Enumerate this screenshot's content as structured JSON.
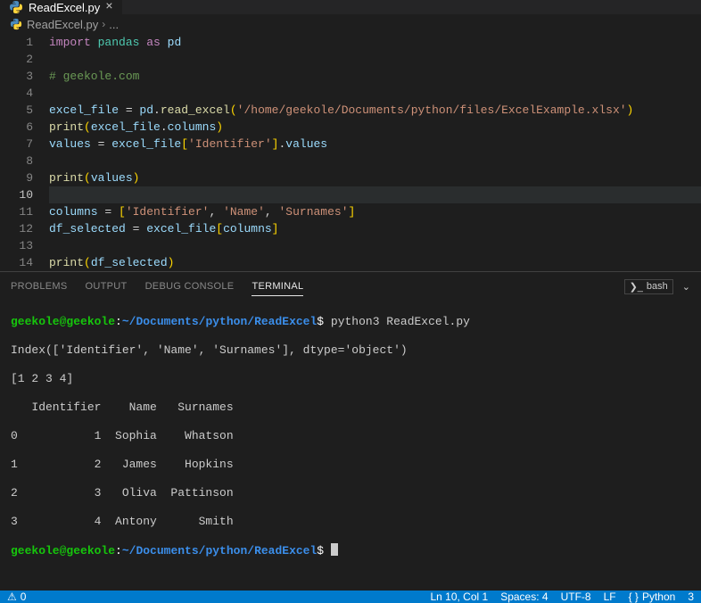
{
  "tab": {
    "filename": "ReadExcel.py"
  },
  "breadcrumb": {
    "filename": "ReadExcel.py",
    "more": "..."
  },
  "code": {
    "l1_import": "import",
    "l1_pandas": "pandas",
    "l1_as": "as",
    "l1_pd": "pd",
    "l3_comment": "# geekole.com",
    "l5_var": "excel_file",
    "l5_eq": " = ",
    "l5_pd": "pd",
    "l5_read": "read_excel",
    "l5_path": "'/home/geekole/Documents/python/files/ExcelExample.xlsx'",
    "l6_print": "print",
    "l6_arg": "excel_file",
    "l6_prop": "columns",
    "l7_values": "values",
    "l7_eq": " = ",
    "l7_file": "excel_file",
    "l7_key": "'Identifier'",
    "l7_valprop": "values",
    "l9_print": "print",
    "l9_arg": "values",
    "l11_cols": "columns",
    "l11_eq": " = ",
    "l11_id": "'Identifier'",
    "l11_name": "'Name'",
    "l11_sur": "'Surnames'",
    "l12_df": "df_selected",
    "l12_eq": " = ",
    "l12_file": "excel_file",
    "l12_cols": "columns",
    "l14_print": "print",
    "l14_arg": "df_selected"
  },
  "lineNumbers": [
    "1",
    "2",
    "3",
    "4",
    "5",
    "6",
    "7",
    "8",
    "9",
    "10",
    "11",
    "12",
    "13",
    "14"
  ],
  "panelTabs": {
    "problems": "PROBLEMS",
    "output": "OUTPUT",
    "debug": "DEBUG CONSOLE",
    "terminal": "TERMINAL"
  },
  "panelRight": {
    "shell": "bash"
  },
  "terminal": {
    "user": "geekole@geekole",
    "colon": ":",
    "path": "~/Documents/python/ReadExcel",
    "dollar": "$",
    "cmd": " python3 ReadExcel.py",
    "out1": "Index(['Identifier', 'Name', 'Surnames'], dtype='object')",
    "out2": "[1 2 3 4]",
    "out3": "   Identifier    Name   Surnames",
    "out4": "0           1  Sophia    Whatson",
    "out5": "1           2   James    Hopkins",
    "out6": "2           3   Oliva  Pattinson",
    "out7": "3           4  Antony      Smith"
  },
  "status": {
    "errors": "0",
    "lncol": "Ln 10, Col 1",
    "spaces": "Spaces: 4",
    "encoding": "UTF-8",
    "eol": "LF",
    "lang": "Python",
    "langver": "3"
  }
}
